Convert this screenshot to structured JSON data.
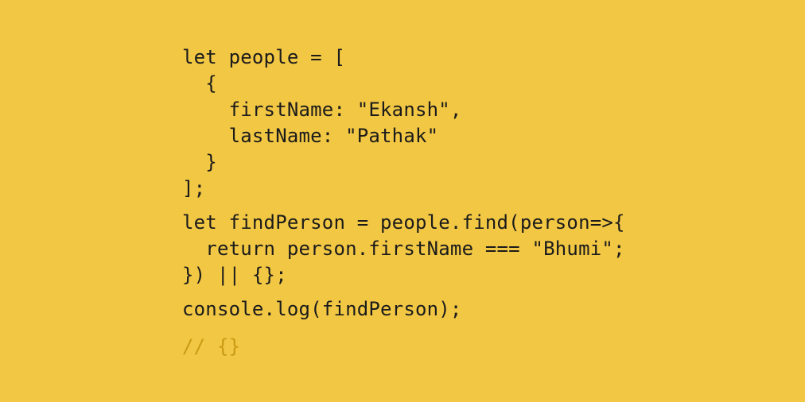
{
  "background_color": "#f2c744",
  "text_color": "#1b1b1b",
  "comment_color": "#c99a12",
  "code": {
    "line_1": "let people = [",
    "line_2": "  {",
    "line_3": "    firstName: \"Ekansh\",",
    "line_4": "    lastName: \"Pathak\"",
    "line_5": "  }",
    "line_6": "];",
    "line_7": "let findPerson = people.find(person=>{",
    "line_8": "  return person.firstName === \"Bhumi\";",
    "line_9": "}) || {};",
    "line_10": "console.log(findPerson);",
    "line_11": "// {}"
  }
}
